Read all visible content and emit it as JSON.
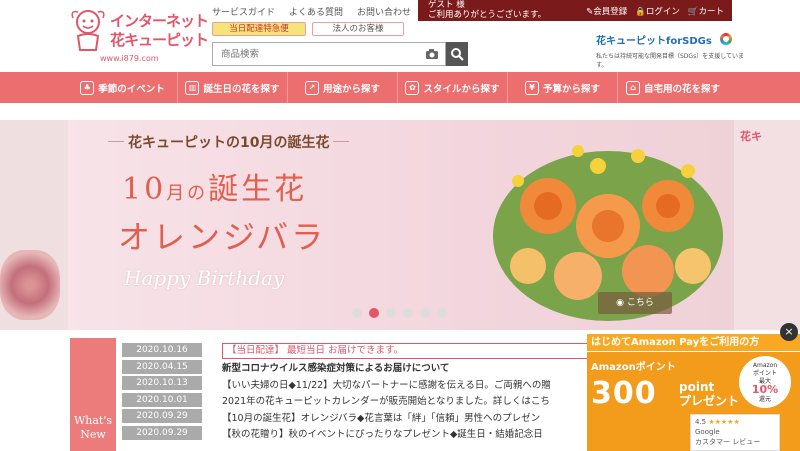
{
  "header": {
    "logo": {
      "line1": "インターネット",
      "line2": "花キューピット",
      "url": "www.i879.com"
    },
    "top_links": [
      "サービスガイド",
      "よくある質問",
      "お問い合わせ"
    ],
    "same_day_label": "当日配達特急便",
    "corporate_label": "法人のお客様",
    "search_placeholder": "商品検索",
    "guest_line1": "ゲスト 様",
    "guest_line2": "ご利用ありがとうございます。",
    "member_register": "会員登録",
    "login": "ログイン",
    "cart": "カート",
    "sdgs_title": "花キューピットforSDGs",
    "sdgs_sub": "私たちは持続可能な開発目標（SDGs）を支援しています。"
  },
  "nav": {
    "items": [
      {
        "label": "季節のイベント",
        "icon": "gift-icon"
      },
      {
        "label": "誕生日の花を探す",
        "icon": "cake-icon"
      },
      {
        "label": "用途から探す",
        "icon": "signpost-icon"
      },
      {
        "label": "スタイルから探す",
        "icon": "flowerpot-icon"
      },
      {
        "label": "予算から探す",
        "icon": "wallet-icon"
      },
      {
        "label": "自宅用の花を探す",
        "icon": "home-icon"
      }
    ]
  },
  "banner": {
    "subtitle": "花キューピットの10月の誕生花",
    "title_num": "10",
    "title_small": "月の",
    "title_rest": "誕生花",
    "title2": "オレンジバラ",
    "script": "Happy Birthday",
    "more": "こちら",
    "right_text": "花キ",
    "active_slide": 2,
    "slide_count": 6
  },
  "news": {
    "label_line1": "What's",
    "label_line2": "New",
    "dates": [
      "2020.10.16",
      "2020.04.15",
      "2020.10.13",
      "2020.10.01",
      "2020.09.29",
      "2020.09.29"
    ],
    "items": [
      "【当日配達】 最短当日 お届けできます。",
      "新型コロナウイルス感染症対策によるお届けについて",
      "【いい夫婦の日◆11/22】大切なパートナーに感謝を伝える日。ご両親への贈",
      "2021年の花キューピットカレンダーが販売開始となりました。詳しくはこち",
      "【10月の誕生花】オレンジバラ◆花言葉は「絆」「信頼」男性へのプレゼン",
      "【秋の花贈り】秋のイベントにぴったりなプレゼント◆誕生日・結婚記念日"
    ]
  },
  "amazon": {
    "header": "はじめてAmazon Payをご利用の方",
    "point_label": "Amazonポイント",
    "points": "300",
    "point_unit": "point",
    "present": "プレゼント",
    "badge_top": "Amazon",
    "badge_mid": "ポイント",
    "badge_max": "最大",
    "badge_pct": "10%",
    "badge_bottom": "還元",
    "close": "×"
  },
  "review": {
    "rating": "4.5",
    "stars": "★★★★★",
    "brand": "Google",
    "text": "カスタマー レビュー"
  }
}
